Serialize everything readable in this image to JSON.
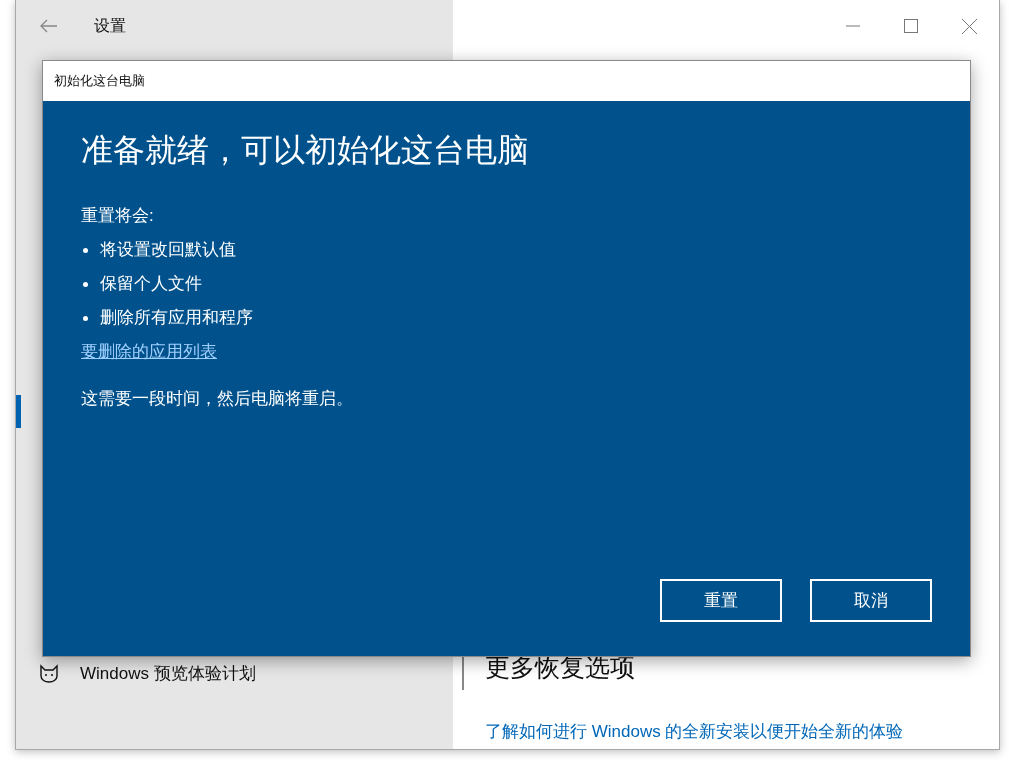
{
  "settings_window": {
    "title": "设置",
    "sidebar": {
      "items": [
        {
          "label": "Windows 预览体验计划"
        }
      ]
    },
    "content": {
      "heading": "更多恢复选项",
      "link": "了解如何进行 Windows 的全新安装以便开始全新的体验"
    }
  },
  "dialog": {
    "title": "初始化这台电脑",
    "heading": "准备就绪，可以初始化这台电脑",
    "intro": "重置将会:",
    "bullets": [
      "将设置改回默认值",
      "保留个人文件",
      "删除所有应用和程序"
    ],
    "link": "要删除的应用列表",
    "note": "这需要一段时间，然后电脑将重启。",
    "buttons": [
      {
        "label": "重置"
      },
      {
        "label": "取消"
      }
    ]
  }
}
